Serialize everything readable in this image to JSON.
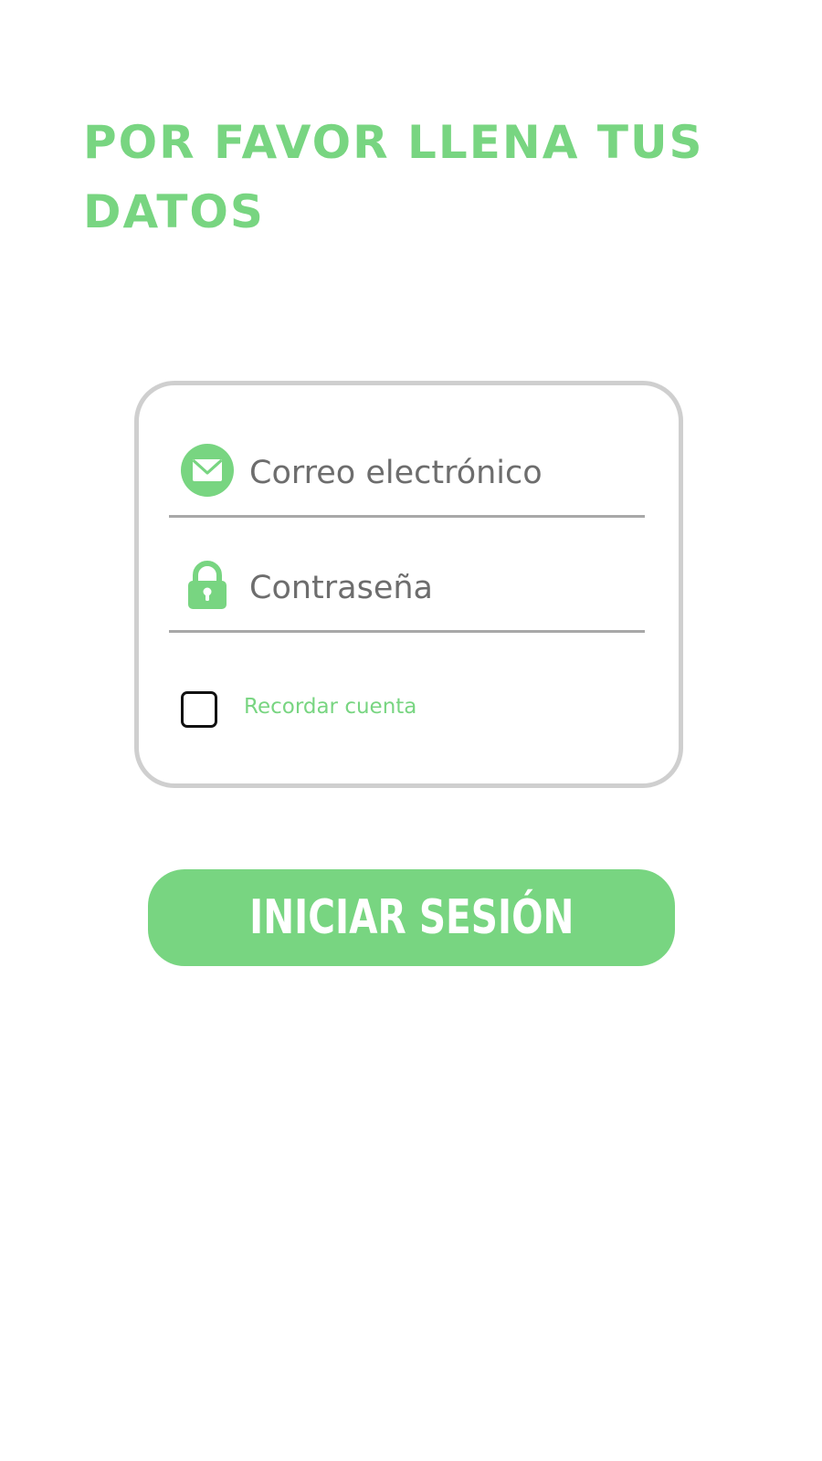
{
  "header": {
    "title": "POR FAVOR LLENA TUS DATOS"
  },
  "form": {
    "email": {
      "placeholder": "Correo electrónico",
      "icon": "mail-icon"
    },
    "password": {
      "placeholder": "Contraseña",
      "icon": "lock-icon"
    },
    "remember": {
      "label": "Recordar cuenta",
      "checked": false
    }
  },
  "login_button": {
    "label": "INICIAR SESIÓN"
  },
  "colors": {
    "accent": "#78d581",
    "card_border": "#cfcfcf",
    "field_underline": "#a8a8a8",
    "placeholder_text": "#6d6d6d",
    "background": "#ffffff"
  }
}
